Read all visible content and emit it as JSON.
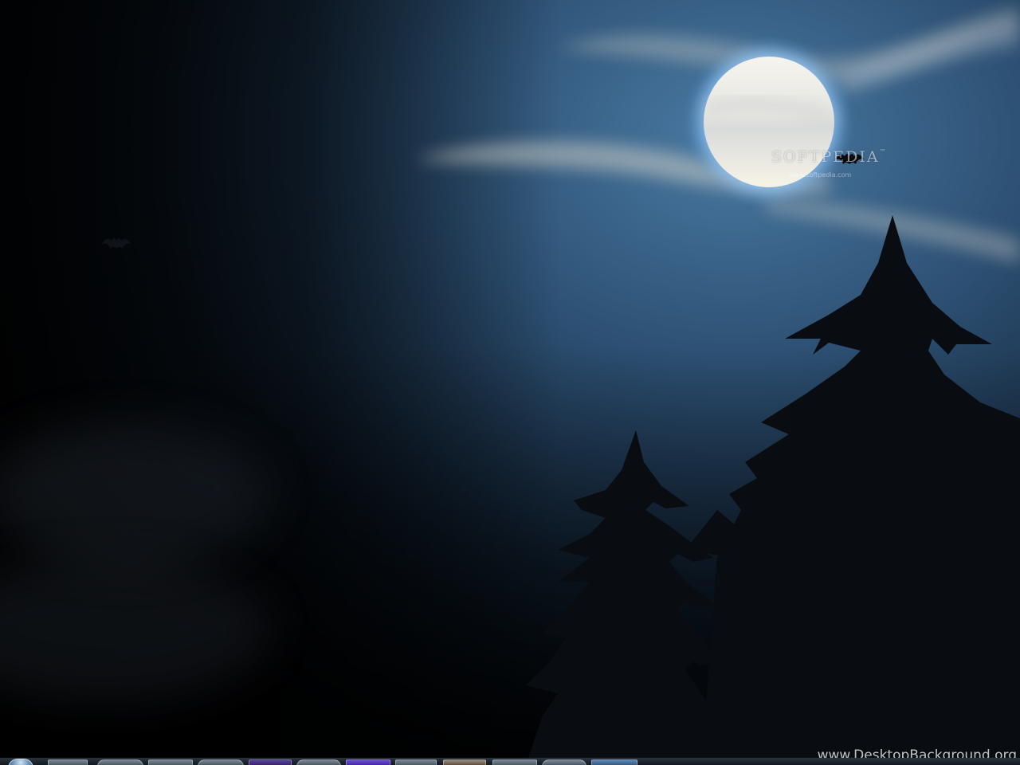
{
  "wallpaper": {
    "softpedia_mark": "SOFTPEDIA",
    "softpedia_tm": "™",
    "softpedia_url": "www.softpedia.com",
    "site_watermark": "www.DesktopBackground.org",
    "colors": {
      "sky_light": "#3d6a93",
      "sky_dark": "#0a1420",
      "moon": "#f2f0e6",
      "moon_glow": "#8fc4ff",
      "tree": "#0a0d12"
    }
  },
  "taskbar": {
    "start_icon": "start-orb-icon",
    "items": [
      {
        "icon": "folder-icon"
      },
      {
        "icon": "browser-icon"
      },
      {
        "icon": "document-icon"
      },
      {
        "icon": "globe-icon"
      },
      {
        "icon": "media-icon"
      },
      {
        "icon": "network-icon"
      },
      {
        "icon": "image-icon"
      },
      {
        "icon": "window-icon"
      },
      {
        "icon": "user-icon"
      },
      {
        "icon": "app-icon"
      },
      {
        "icon": "search-icon"
      },
      {
        "icon": "monitor-icon"
      }
    ]
  }
}
